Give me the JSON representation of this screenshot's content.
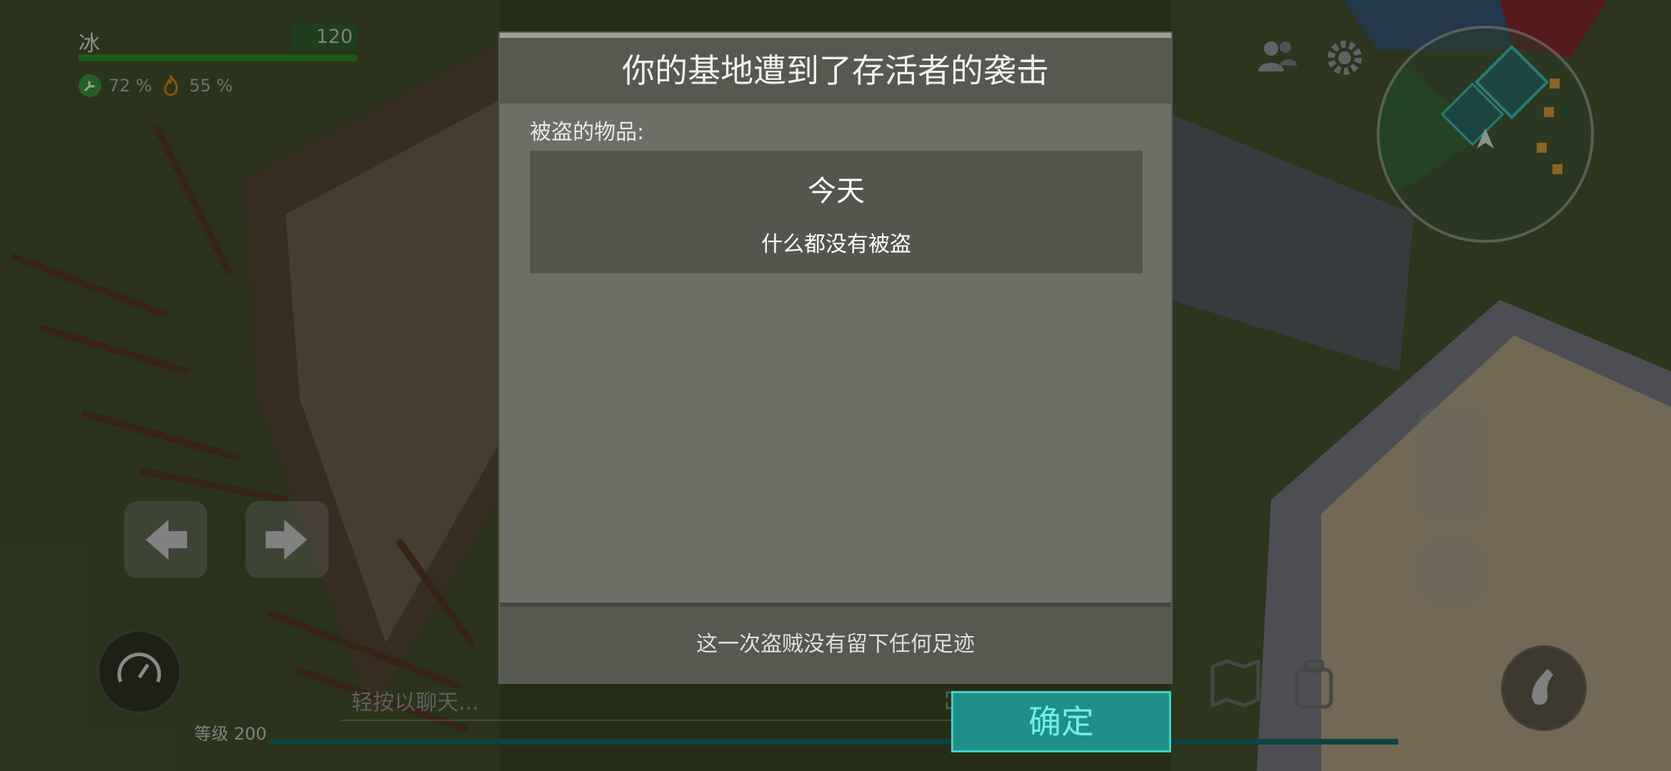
{
  "hud": {
    "player_name": "冰",
    "hp_value": "120",
    "hp_fill_fraction": 1.0,
    "tool_stat": "72 %",
    "fire_stat": "55 %",
    "level_label": "等级 200",
    "chat_placeholder": "轻按以聊天...",
    "icons": [
      "wrench-icon",
      "flame-icon",
      "friends-icon",
      "settings-gear-icon",
      "arrow-left-icon",
      "arrow-right-icon",
      "speedometer-icon",
      "map-icon",
      "backpack-icon",
      "grab-hand-icon",
      "expand-icon"
    ]
  },
  "modal": {
    "title": "你的基地遭到了存活者的袭击",
    "stolen_label": "被盗的物品:",
    "day_title": "今天",
    "day_text": "什么都没有被盗",
    "footer_text": "这一次盗贼没有留下任何足迹",
    "confirm_label": "确定"
  },
  "colors": {
    "accent_teal": "#1f8f87",
    "confirm_text": "#6ff0e4",
    "hp_green": "#2f8f2f",
    "modal_body": "#6b6f66",
    "modal_header": "#55594f"
  }
}
